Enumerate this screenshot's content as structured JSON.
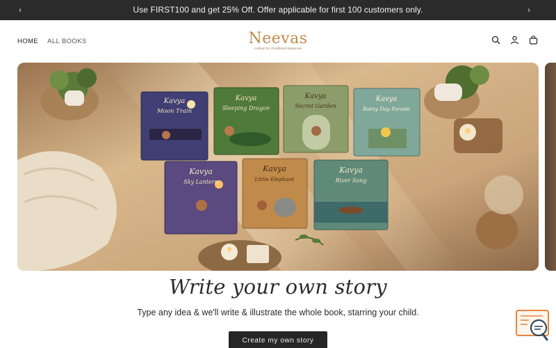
{
  "announcement": {
    "text": "Use FIRST100 and get 25% Off. Offer applicable for first 100 customers only.",
    "prev_icon": "chevron-left-icon",
    "next_icon": "chevron-right-icon"
  },
  "header": {
    "nav": [
      {
        "label": "HOME"
      },
      {
        "label": "ALL BOOKS"
      }
    ],
    "logo": {
      "name": "Neevas",
      "tagline": "crafted for childhood memories"
    },
    "icons": [
      "search-icon",
      "account-icon",
      "cart-icon"
    ]
  },
  "hero": {
    "books_row1": [
      {
        "kavya": "Kavya",
        "title": "Moon Train"
      },
      {
        "kavya": "Kavya",
        "title": "Sleeping Dragon"
      },
      {
        "kavya": "Kavya",
        "title": "Secret Garden"
      },
      {
        "kavya": "Kavya",
        "title": "Rainy Day Parade"
      }
    ],
    "books_row2": [
      {
        "kavya": "Kavya",
        "title": "Sky Lantern"
      },
      {
        "kavya": "Kavya",
        "title": "Little Elephant"
      },
      {
        "kavya": "Kavya",
        "title": "River Song"
      }
    ]
  },
  "main": {
    "headline": "Write your own story",
    "subline": "Type any idea & we'll write & illustrate the whole book, starring your child.",
    "cta_label": "Create my own story"
  },
  "colors": {
    "announcement_bg": "#2b2b2b",
    "logo": "#c0894a",
    "cta_bg": "#262626",
    "chat_accent": "#e8843c"
  }
}
